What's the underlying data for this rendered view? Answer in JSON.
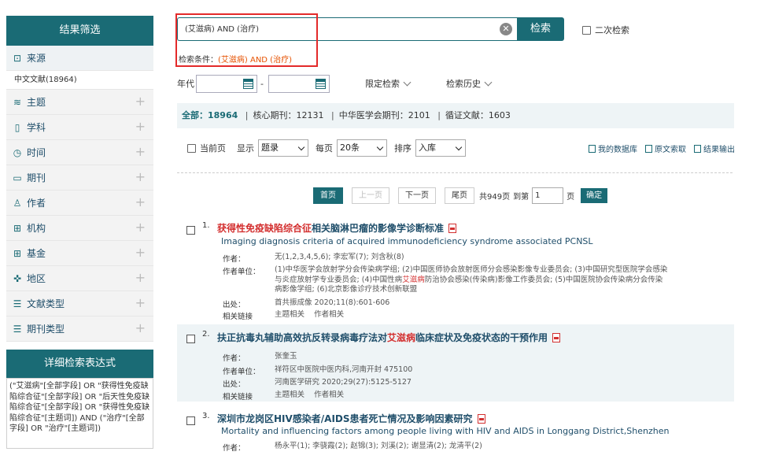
{
  "sidebar": {
    "filter_title": "结果筛选",
    "source_label": "来源",
    "source_item": "中文文献(18964)",
    "facets": [
      {
        "label": "主题",
        "icon": "layers-icon"
      },
      {
        "label": "学科",
        "icon": "book-icon"
      },
      {
        "label": "时间",
        "icon": "clock-icon"
      },
      {
        "label": "期刊",
        "icon": "open-book-icon"
      },
      {
        "label": "作者",
        "icon": "user-icon"
      },
      {
        "label": "机构",
        "icon": "institution-icon"
      },
      {
        "label": "基金",
        "icon": "fund-icon"
      },
      {
        "label": "地区",
        "icon": "globe-icon"
      },
      {
        "label": "文献类型",
        "icon": "list-icon"
      },
      {
        "label": "期刊类型",
        "icon": "list-icon"
      }
    ],
    "detail_title": "详细检索表达式",
    "detail_expr": "(\"艾滋病\"[全部字段] OR \"获得性免疫缺陷综合征\"[全部字段] OR \"后天性免疫缺陷综合征\"[全部字段] OR \"获得性免疫缺陷综合征\"[主题词]) AND (\"治疗\"[全部字段] OR \"治疗\"[主题词])"
  },
  "search": {
    "query": "(艾滋病) AND (治疗)",
    "button": "检索",
    "secondary": "二次检索",
    "cond_label": "检索条件：",
    "cond_value": "(艾滋病) AND (治疗)"
  },
  "filters": {
    "year_label": "年代",
    "dash": "-",
    "limit": "限定检索",
    "history": "检索历史"
  },
  "stats": {
    "all_label": "全部：",
    "all_count": "18964",
    "core": "核心期刊：12131",
    "cma": "中华医学会期刊：2101",
    "evidence": "循证文献：1603"
  },
  "toolbar": {
    "current_page": "当前页",
    "show": "显示",
    "show_value": "题录",
    "per_page": "每页",
    "per_value": "20条",
    "sort": "排序",
    "sort_value": "入库",
    "my_db": "我的数据库",
    "full_text": "原文索取",
    "export": "结果输出"
  },
  "pager": {
    "first": "首页",
    "prev": "上一页",
    "next": "下一页",
    "last": "尾页",
    "total": "共949页",
    "goto": "到第",
    "page_value": "1",
    "page_unit": "页",
    "ok": "确定"
  },
  "results": [
    {
      "num": "1.",
      "title_hl": "获得性免疫缺陷综合征",
      "title_rest": "相关脑淋巴瘤的影像学诊断标准",
      "etitle": "Imaging diagnosis criteria of acquired immunodeficiency syndrome associated PCNSL",
      "author_k": "作者：",
      "author_v": "无(1,2,3,4,5,6); 李宏军(7); 刘含秋(8)",
      "unit_k": "作者单位：",
      "unit_v1": "(1)中华医学会放射学分会传染病学组; (2)中国医师协会放射医师分会感染影像专业委员会; (3)中国研究型医院学会感染与炎症放射学专业委员会; (4)中国性病",
      "unit_hl": "艾滋病",
      "unit_v2": "防治协会感染(传染病)影像工作委员会; (5)中国医院协会传染病分会传染病影像学组; (6)北京影像诊疗技术创新联盟",
      "pub_k": "出处：",
      "pub_v": "首共振成像 2020;11(8):601-606",
      "link_k": "相关链接",
      "link_v1": "主题相关",
      "link_v2": "作者相关"
    },
    {
      "num": "2.",
      "title_a": "扶正抗毒丸辅助高效抗反转录病毒疗法对",
      "title_hl": "艾滋病",
      "title_b": "临床症状及免疫状态的干预作用",
      "author_k": "作者：",
      "author_v": "张奎玉",
      "unit_k": "作者单位：",
      "unit_v": "祥符区中医院中医内科,河南开封 475100",
      "pub_k": "出处：",
      "pub_v": "河南医学研究 2020;29(27):5125-5127",
      "link_k": "相关链接",
      "link_v1": "主题相关",
      "link_v2": "作者相关"
    },
    {
      "num": "3.",
      "title": "深圳市龙岗区HIV感染者/AIDS患者死亡情况及影响因素研究",
      "etitle": "Mortality and influencing factors among people living with HIV and AIDS in Longgang District,Shenzhen",
      "author_k": "作者：",
      "author_v": "杨永平(1); 李骁霞(2); 赵锦(3); 刘溪(2); 谢显清(2); 龙清平(2)"
    }
  ]
}
